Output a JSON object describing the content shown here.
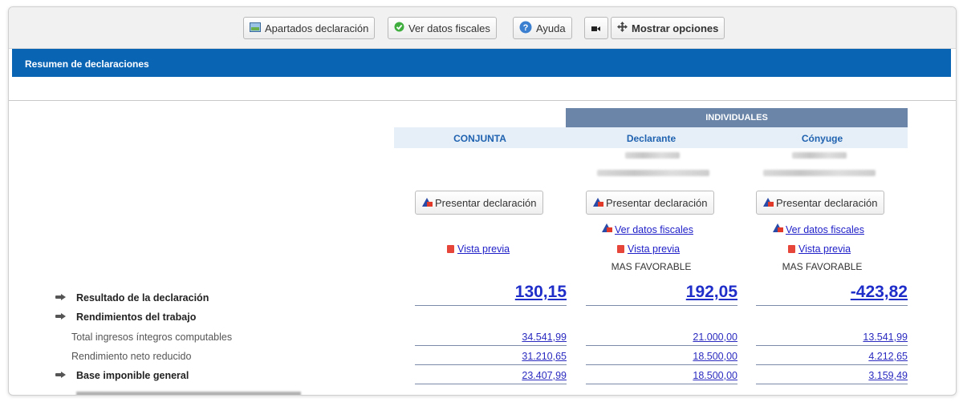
{
  "toolbar": {
    "apartados": "Apartados declaración",
    "ver_datos": "Ver datos fiscales",
    "ayuda": "Ayuda",
    "mostrar": "Mostrar opciones"
  },
  "bar_title": "Resumen de declaraciones",
  "individuales": "INDIVIDUALES",
  "columns": {
    "conjunta": "CONJUNTA",
    "declarante": "Declarante",
    "conyuge": "Cónyuge"
  },
  "actions": {
    "presentar": "Presentar declaración",
    "ver_datos": "Ver datos fiscales",
    "vista_previa": "Vista previa",
    "mas_favorable": "MAS FAVORABLE"
  },
  "rows": {
    "resultado": {
      "label": "Resultado de la declaración",
      "conjunta": "130,15",
      "declarante": "192,05",
      "conyuge": "-423,82"
    },
    "rendimientos": {
      "label": "Rendimientos del trabajo"
    },
    "total_ingresos": {
      "label": "Total ingresos íntegros computables",
      "conjunta": "34.541,99",
      "declarante": "21.000,00",
      "conyuge": "13.541,99"
    },
    "rend_neto": {
      "label": "Rendimiento neto reducido",
      "conjunta": "31.210,65",
      "declarante": "18.500,00",
      "conyuge": "4.212,65"
    },
    "base_imponible": {
      "label": "Base imponible general",
      "conjunta": "23.407,99",
      "declarante": "18.500,00",
      "conyuge": "3.159,49"
    }
  },
  "colors": {
    "header_bar": "#0a64b4",
    "individuales_bg": "#6b85a8",
    "link": "#2020c8",
    "column_header": "#1f62b0"
  }
}
